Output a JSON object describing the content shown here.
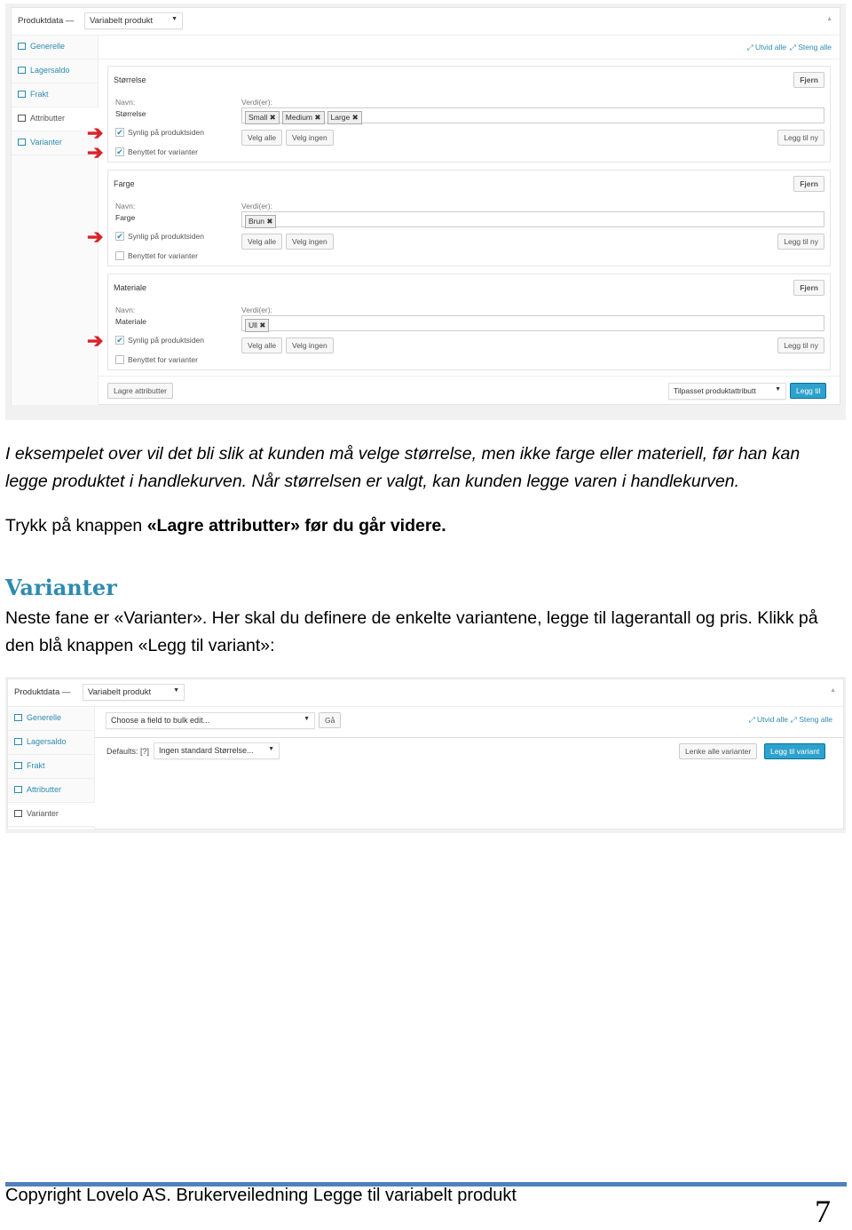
{
  "shot1": {
    "header_label": "Produktdata —",
    "product_type": "Variabelt produkt",
    "tabs": [
      {
        "label": "Generelle",
        "icon": "list-icon"
      },
      {
        "label": "Lagersaldo",
        "icon": "chart-icon"
      },
      {
        "label": "Frakt",
        "icon": "truck-icon"
      },
      {
        "label": "Attributter",
        "icon": "attribute-icon",
        "active": true
      },
      {
        "label": "Varianter",
        "icon": "window-icon"
      }
    ],
    "expand_all": "Utvid alle",
    "close_all": "Steng alle",
    "name_label": "Navn:",
    "values_label": "Verdi(er):",
    "remove": "Fjern",
    "select_all": "Velg alle",
    "select_none": "Velg ingen",
    "add_new": "Legg til ny",
    "visible_label": "Synlig på produktsiden",
    "variation_label": "Benyttet for varianter",
    "attributes": [
      {
        "title": "Størrelse",
        "name": "Størrelse",
        "values": [
          "Small",
          "Medium",
          "Large"
        ],
        "visible": true,
        "variation": true
      },
      {
        "title": "Farge",
        "name": "Farge",
        "values": [
          "Brun"
        ],
        "visible": true,
        "variation": false
      },
      {
        "title": "Materiale",
        "name": "Materiale",
        "values": [
          "Ull"
        ],
        "visible": true,
        "variation": false
      }
    ],
    "save_button": "Lagre attributter",
    "custom_select": "Tilpasset produktattributt",
    "add_button": "Legg til",
    "accent": "#2ea2cc",
    "arrow_color": "#d8232a"
  },
  "text": {
    "p1_line1": "I eksempelet over vil det bli slik at kunden må velge størrelse, men ikke farge eller materiell, før han kan",
    "p1_line2": "legge produktet i handlekurven. Når størrelsen er valgt, kan kunden legge varen i handlekurven.",
    "p2_plain": "Trykk på knappen ",
    "p2_bold": "«Lagre attributter» før du går videre.",
    "heading": "Varianter",
    "p3_line1": "Neste fane er «Varianter». Her skal du definere de enkelte variantene, legge til lagerantall og pris. Klikk på",
    "p3_line2": "den blå knappen «Legg til variant»:"
  },
  "shot2": {
    "header_label": "Produktdata —",
    "product_type": "Variabelt produkt",
    "tabs": [
      {
        "label": "Generelle",
        "icon": "list-icon"
      },
      {
        "label": "Lagersaldo",
        "icon": "chart-icon"
      },
      {
        "label": "Frakt",
        "icon": "truck-icon"
      },
      {
        "label": "Attributter",
        "icon": "attribute-icon"
      },
      {
        "label": "Varianter",
        "icon": "window-icon",
        "active": true
      }
    ],
    "bulk_select": "Choose a field to bulk edit...",
    "go": "Gå",
    "expand_all": "Utvid alle",
    "close_all": "Steng alle",
    "defaults_label": "Defaults: [?]",
    "default_select": "Ingen standard Størrelse...",
    "link_all": "Lenke alle varianter",
    "add_variant": "Legg til variant"
  },
  "footer": {
    "text": "Copyright Lovelo AS. Brukerveiledning Legge til variabelt produkt",
    "page": "7",
    "rule_color": "#4f81bd"
  }
}
